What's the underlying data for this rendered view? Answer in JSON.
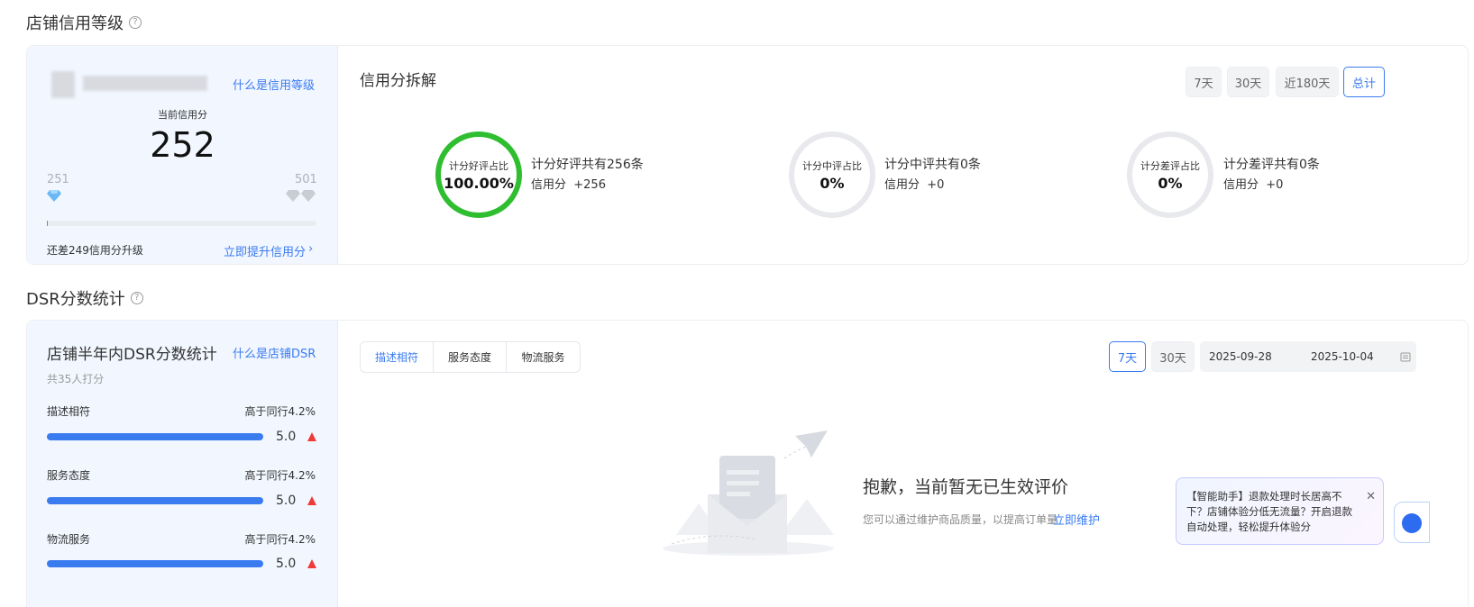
{
  "credit_section": {
    "title": "店铺信用等级",
    "what_is_link": "什么是信用等级",
    "current_label": "当前信用分",
    "current_score": "252",
    "range_min": "251",
    "range_max": "501",
    "progress_fraction": 0.004,
    "remaining_text": "还差249信用分升级",
    "improve_link": "立即提升信用分",
    "improve_chevron": "›",
    "breakdown_title": "信用分拆解",
    "range_buttons": [
      "7天",
      "30天",
      "近180天",
      "总计"
    ],
    "active_range": "总计",
    "rings": [
      {
        "label": "计分好评占比",
        "value": "100.00%",
        "line1": "计分好评共有256条",
        "line2": "信用分  +256",
        "color": "#2fbe2f",
        "fraction": 1.0
      },
      {
        "label": "计分中评占比",
        "value": "0%",
        "line1": "计分中评共有0条",
        "line2": "信用分  +0",
        "color": "#e8e9ed",
        "fraction": 0
      },
      {
        "label": "计分差评占比",
        "value": "0%",
        "line1": "计分差评共有0条",
        "line2": "信用分  +0",
        "color": "#e8e9ed",
        "fraction": 0
      }
    ]
  },
  "dsr_section": {
    "title": "DSR分数统计",
    "card_title": "店铺半年内DSR分数统计",
    "what_is_link": "什么是店铺DSR",
    "raters": "共35人打分",
    "items": [
      {
        "name": "描述相符",
        "compare": "高于同行4.2%",
        "score": "5.0",
        "fraction": 1.0
      },
      {
        "name": "服务态度",
        "compare": "高于同行4.2%",
        "score": "5.0",
        "fraction": 1.0
      },
      {
        "name": "物流服务",
        "compare": "高于同行4.2%",
        "score": "5.0",
        "fraction": 1.0
      }
    ],
    "tabs": [
      "描述相符",
      "服务态度",
      "物流服务"
    ],
    "active_tab": "描述相符",
    "range_buttons": [
      "7天",
      "30天"
    ],
    "active_range": "7天",
    "date_start": "2025-09-28",
    "date_end": "2025-10-04",
    "empty_title": "抱歉，当前暂无已生效评价",
    "empty_desc": "您可以通过维护商品质量，以提高订单量",
    "empty_link": "立即维护"
  },
  "assistant_popup": {
    "text": "【智能助手】退款处理时长居高不下？店铺体验分低无流量？开启退款自动处理，轻松提升体验分",
    "close_symbol": "✕"
  },
  "colors": {
    "accent": "#3a7bf0",
    "good": "#2fbe2f",
    "warn": "#f03a3a",
    "panel_bg": "#f2f7ff"
  }
}
